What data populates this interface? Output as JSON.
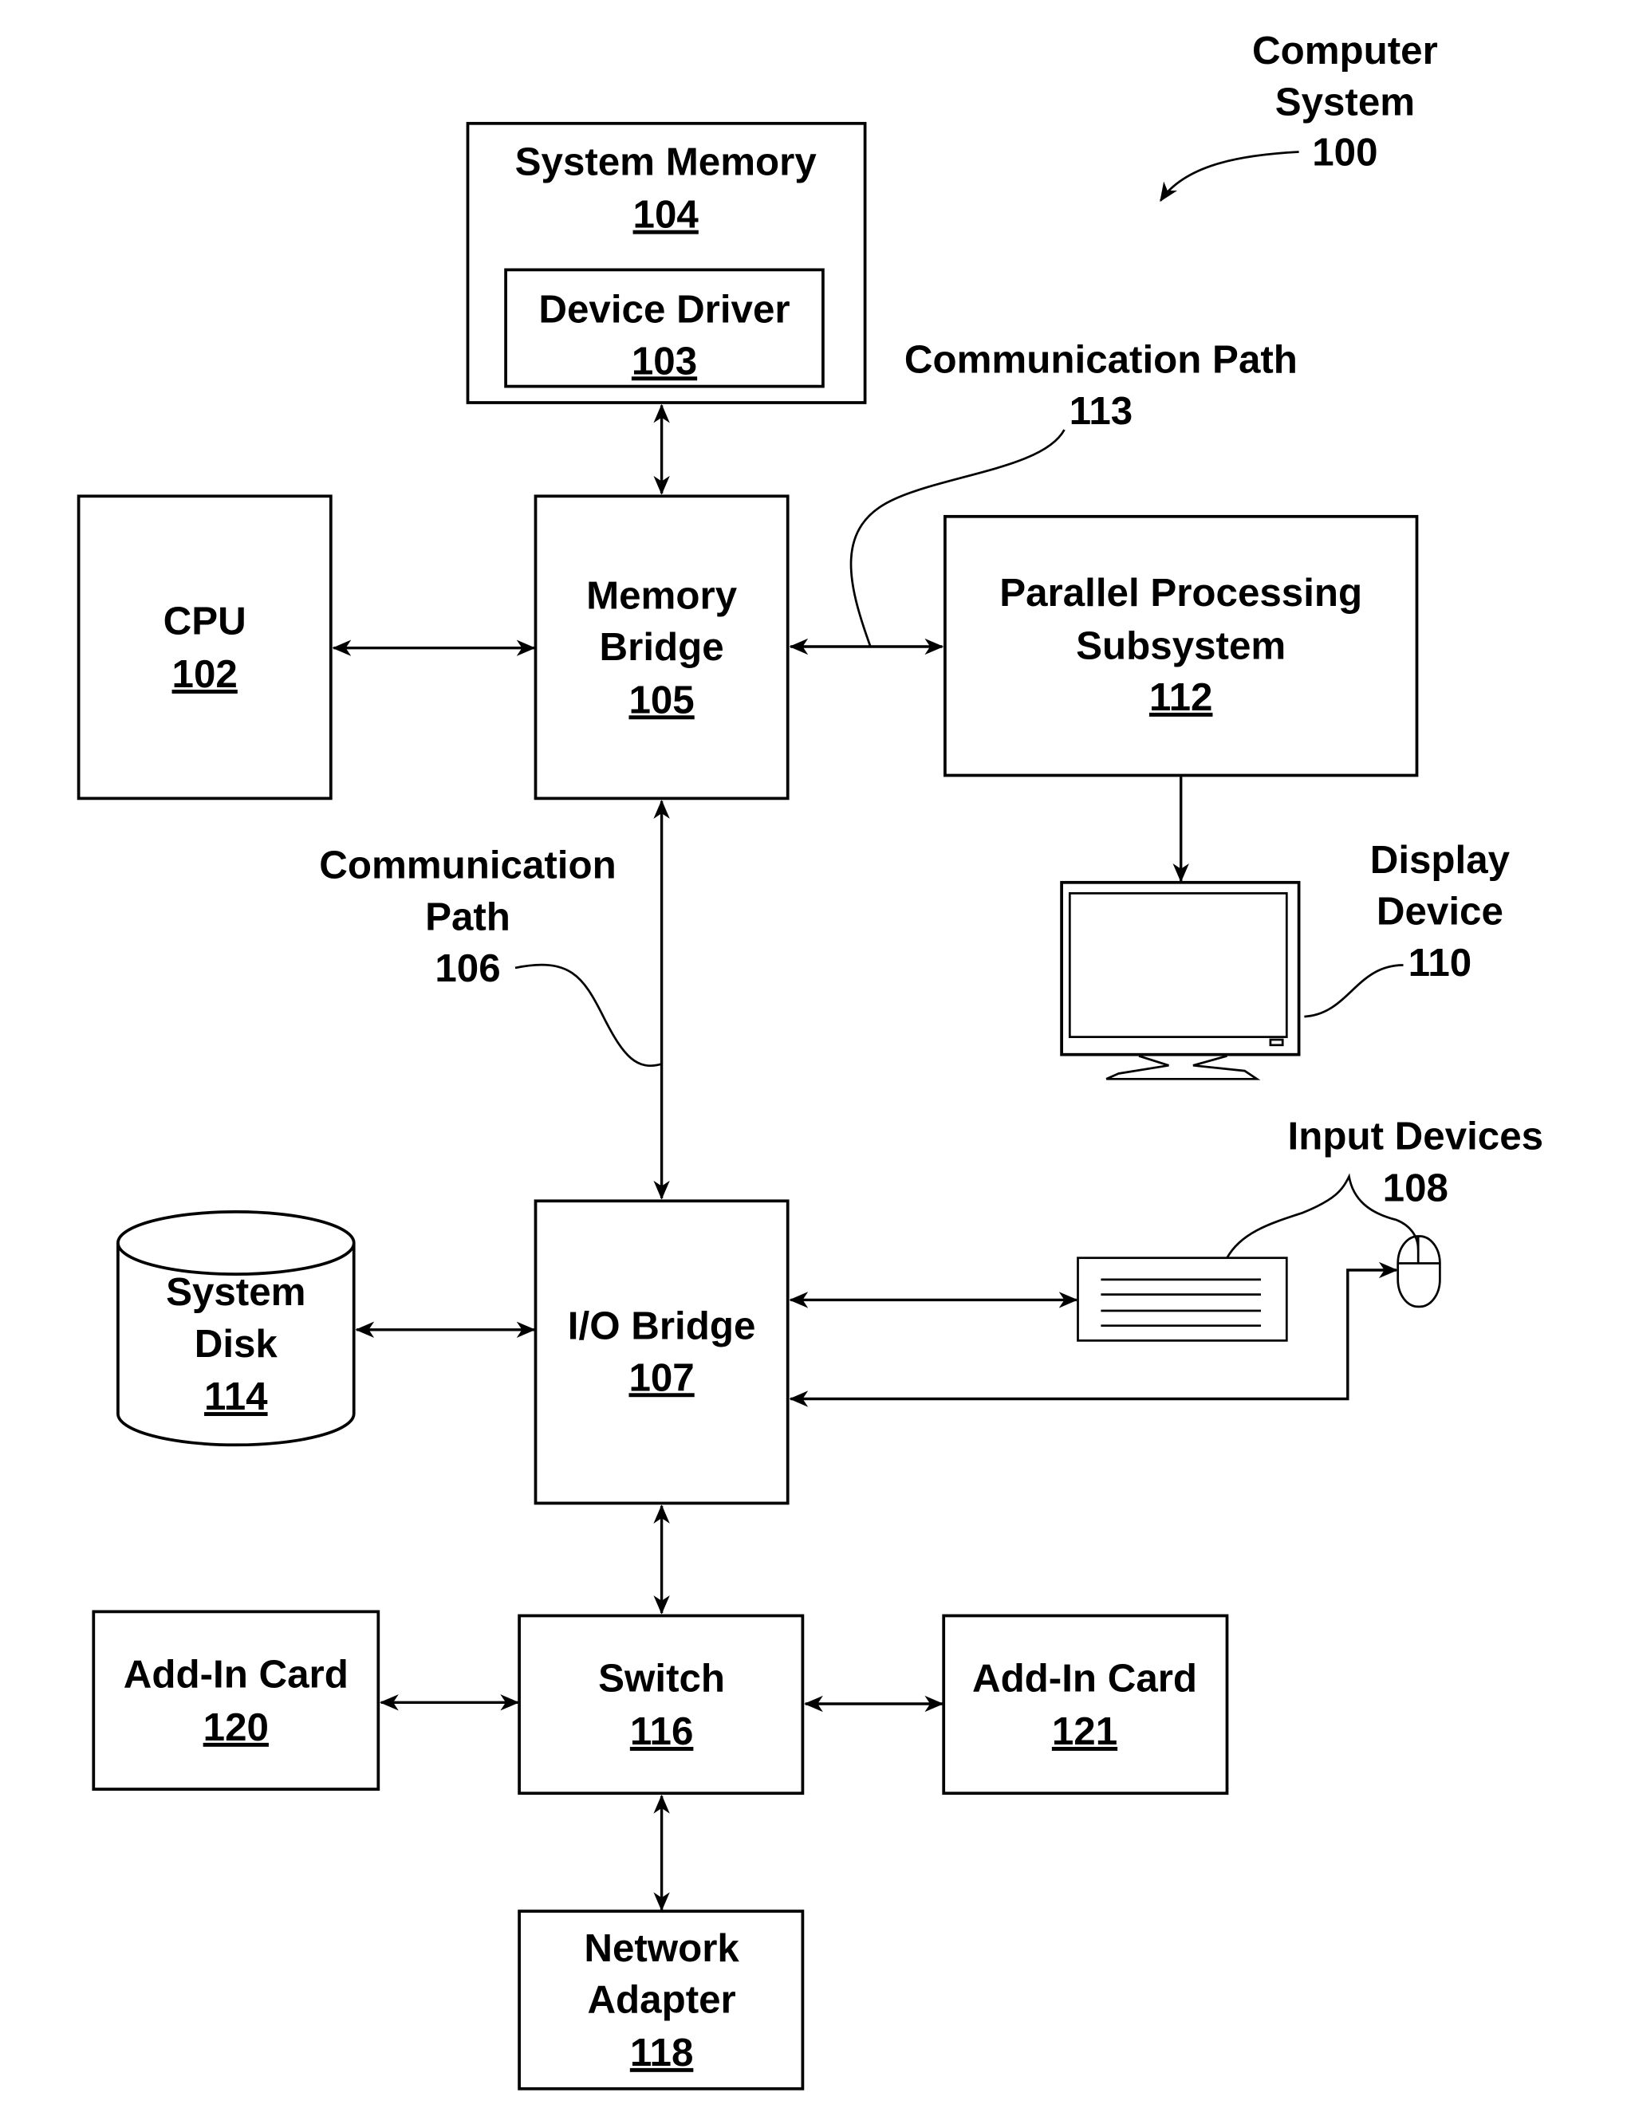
{
  "figure": {
    "title": {
      "line1": "Computer",
      "line2": "System",
      "ref": "100"
    },
    "nodes": {
      "system_memory": {
        "label": "System Memory",
        "ref": "104"
      },
      "device_driver": {
        "label": "Device Driver",
        "ref": "103"
      },
      "cpu": {
        "label": "CPU",
        "ref": "102"
      },
      "memory_bridge": {
        "line1": "Memory",
        "line2": "Bridge",
        "ref": "105"
      },
      "parallel_processing": {
        "line1": "Parallel Processing",
        "line2": "Subsystem",
        "ref": "112"
      },
      "display_device": {
        "line1": "Display",
        "line2": "Device",
        "ref": "110"
      },
      "input_devices": {
        "label": "Input Devices",
        "ref": "108"
      },
      "io_bridge": {
        "label": "I/O Bridge",
        "ref": "107"
      },
      "system_disk": {
        "line1": "System",
        "line2": "Disk",
        "ref": "114"
      },
      "switch": {
        "label": "Switch",
        "ref": "116"
      },
      "add_in_card_120": {
        "label": "Add-In Card",
        "ref": "120"
      },
      "add_in_card_121": {
        "label": "Add-In Card",
        "ref": "121"
      },
      "network_adapter": {
        "line1": "Network",
        "line2": "Adapter",
        "ref": "118"
      }
    },
    "paths": {
      "comm_path_113": {
        "label": "Communication Path",
        "ref": "113"
      },
      "comm_path_106": {
        "line1": "Communication",
        "line2": "Path",
        "ref": "106"
      }
    },
    "edges": [
      {
        "from": "system_memory",
        "to": "memory_bridge",
        "direction": "bidirectional"
      },
      {
        "from": "cpu",
        "to": "memory_bridge",
        "direction": "bidirectional"
      },
      {
        "from": "memory_bridge",
        "to": "parallel_processing",
        "direction": "bidirectional",
        "via": "comm_path_113"
      },
      {
        "from": "parallel_processing",
        "to": "display_device",
        "direction": "forward"
      },
      {
        "from": "memory_bridge",
        "to": "io_bridge",
        "direction": "bidirectional",
        "via": "comm_path_106"
      },
      {
        "from": "system_disk",
        "to": "io_bridge",
        "direction": "bidirectional"
      },
      {
        "from": "io_bridge",
        "to": "keyboard",
        "direction": "bidirectional"
      },
      {
        "from": "mouse",
        "to": "io_bridge",
        "direction": "bidirectional"
      },
      {
        "from": "io_bridge",
        "to": "switch",
        "direction": "bidirectional"
      },
      {
        "from": "add_in_card_120",
        "to": "switch",
        "direction": "bidirectional"
      },
      {
        "from": "switch",
        "to": "add_in_card_121",
        "direction": "bidirectional"
      },
      {
        "from": "switch",
        "to": "network_adapter",
        "direction": "bidirectional"
      }
    ]
  }
}
